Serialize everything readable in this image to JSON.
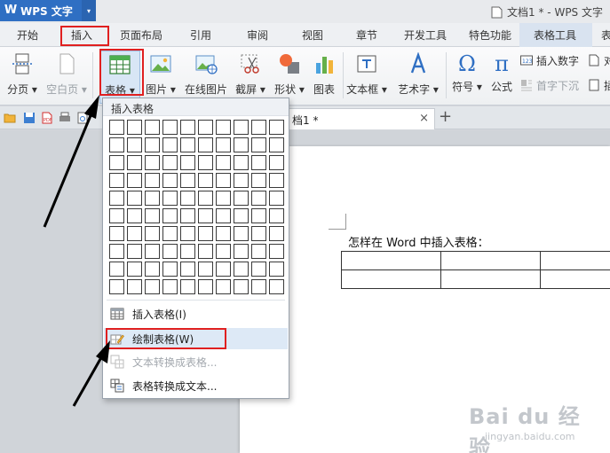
{
  "titlebar": {
    "app_logo": "W",
    "app_name": "WPS 文字",
    "doc_title": "文档1 * - WPS 文字"
  },
  "tabs": [
    "开始",
    "插入",
    "页面布局",
    "引用",
    "审阅",
    "视图",
    "章节",
    "开发工具",
    "特色功能",
    "表格工具",
    "表"
  ],
  "ribbon": {
    "page_break": "分页 ▾",
    "blank_page": "空白页 ▾",
    "table": "表格 ▾",
    "picture": "图片 ▾",
    "online_picture": "在线图片",
    "screenshot": "截屏 ▾",
    "shape": "形状 ▾",
    "chart": "图表",
    "textbox": "文本框 ▾",
    "wordart": "艺术字 ▾",
    "symbol": "符号 ▾",
    "formula": "公式",
    "insert_number": "插入数字",
    "object": "对",
    "drop_cap": "首字下沉",
    "insert_clip": "插"
  },
  "doc_tab": {
    "label": "档1 *",
    "close": "×",
    "new": "+"
  },
  "document": {
    "text": "怎样在 Word 中插入表格："
  },
  "dropdown": {
    "header": "插入表格",
    "items": {
      "insert_table": "插入表格(I)",
      "draw_table": "绘制表格(W)",
      "text_to_table": "文本转换成表格...",
      "table_to_text": "表格转换成文本..."
    }
  },
  "watermark": {
    "brand": "Bai du 经验",
    "url": "jingyan.baidu.com"
  },
  "colors": {
    "accent": "#2f6fc3",
    "annotation_red": "#e02020",
    "hover": "#dde9f6"
  }
}
